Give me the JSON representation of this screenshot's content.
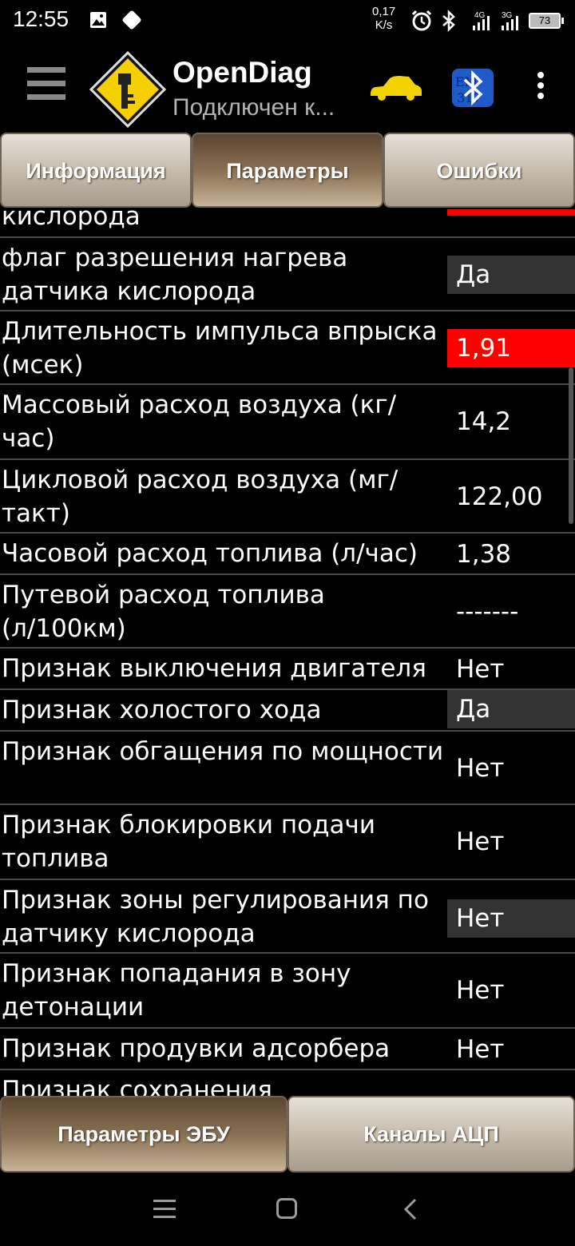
{
  "status_bar": {
    "time": "12:55",
    "net_speed_value": "0,17",
    "net_speed_unit": "K/s",
    "signal1": "4G",
    "signal2": "3G",
    "battery": "73",
    "icons": [
      "image-icon",
      "diamond-icon",
      "alarm-icon",
      "bluetooth-icon",
      "signal-icon",
      "battery-icon"
    ]
  },
  "app_bar": {
    "title": "OpenDiag",
    "subtitle": "Подключен к...",
    "accent_logo": "#f5d000",
    "car_color": "#f2d300"
  },
  "tabs": [
    {
      "label": "Информация",
      "active": false
    },
    {
      "label": "Параметры",
      "active": true
    },
    {
      "label": "Ошибки",
      "active": false
    }
  ],
  "params": [
    {
      "label": "кислорода",
      "value": "",
      "style": "red"
    },
    {
      "label": "флаг разрешения нагрева датчика кислорода",
      "value": "Да",
      "style": "gray"
    },
    {
      "label": "Длительность импульса впрыска (мсек)",
      "value": "1,91",
      "style": "red"
    },
    {
      "label": "Массовый расход воздуха (кг/час)",
      "value": "14,2",
      "style": "none"
    },
    {
      "label": "Цикловой расход воздуха (мг/такт)",
      "value": "122,00",
      "style": "none"
    },
    {
      "label": "Часовой расход топлива (л/час)",
      "value": "1,38",
      "style": "none"
    },
    {
      "label": "Путевой расход топлива (л/100км)",
      "value": "-------",
      "style": "none"
    },
    {
      "label": "Признак выключения двигателя",
      "value": "Нет",
      "style": "none"
    },
    {
      "label": "Признак холостого хода",
      "value": "Да",
      "style": "gray"
    },
    {
      "label": "Признак обгащения по мощности",
      "value": "Нет",
      "style": "none"
    },
    {
      "label": "Признак блокировки подачи топлива",
      "value": "Нет",
      "style": "none"
    },
    {
      "label": "Признак зоны регулирования по датчику кислорода",
      "value": "Нет",
      "style": "gray"
    },
    {
      "label": "Признак попадания в зону детонации",
      "value": "Нет",
      "style": "none"
    },
    {
      "label": "Признак продувки адсорбера",
      "value": "Нет",
      "style": "none"
    },
    {
      "label": "Признак сохранения",
      "value": "",
      "style": "none"
    }
  ],
  "bottom_tabs": [
    {
      "label": "Параметры ЭБУ",
      "active": true
    },
    {
      "label": "Каналы АЦП",
      "active": false
    }
  ],
  "nav_bar": {
    "icons": [
      "menu-icon",
      "home-icon",
      "back-icon"
    ]
  }
}
